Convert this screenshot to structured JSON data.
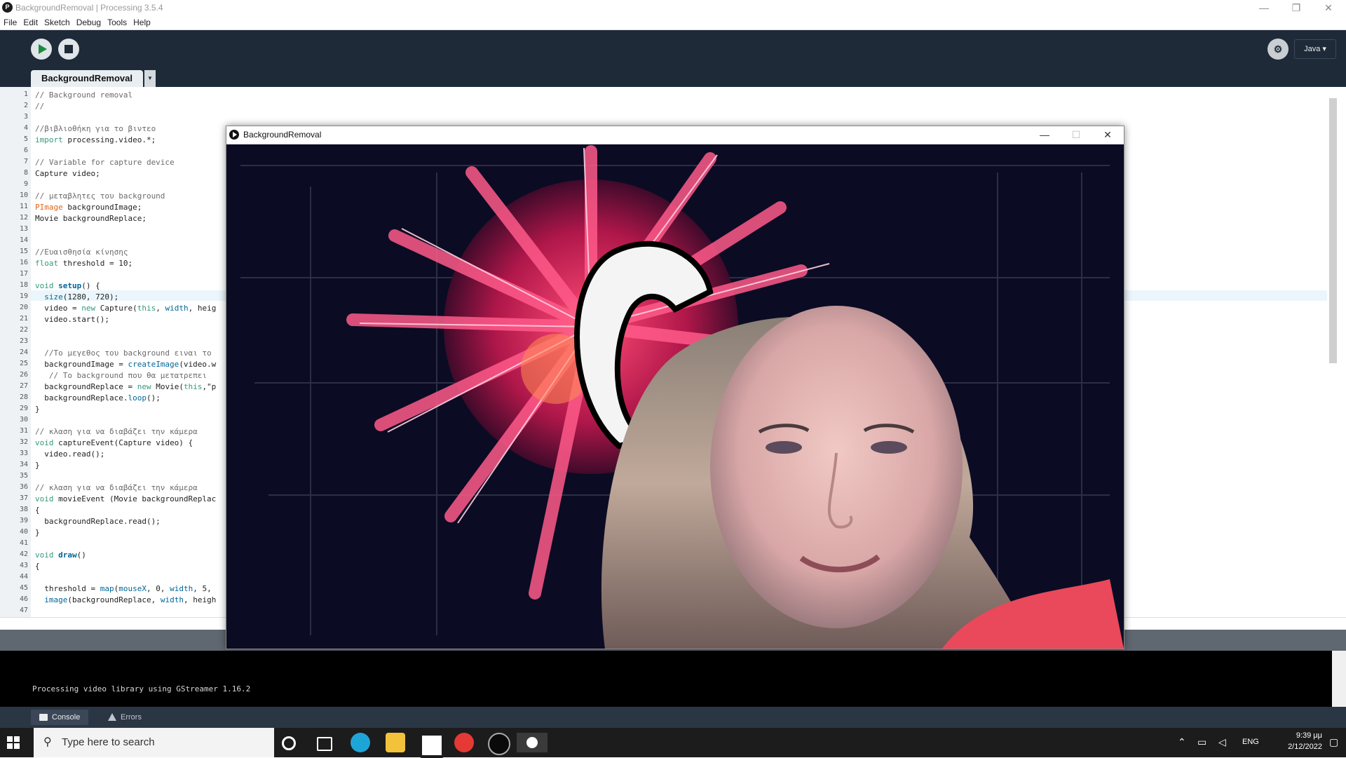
{
  "window": {
    "title": "BackgroundRemoval | Processing 3.5.4",
    "logo_letter": "P"
  },
  "window_controls": {
    "minimize": "—",
    "maximize": "❐",
    "close": "✕"
  },
  "menu": [
    "File",
    "Edit",
    "Sketch",
    "Debug",
    "Tools",
    "Help"
  ],
  "toolbar": {
    "run_icon": "play-icon",
    "stop_icon": "stop-icon",
    "debug_icon": "debug-icon",
    "mode": "Java ▾"
  },
  "tab": {
    "label": "BackgroundRemoval",
    "menu_glyph": "▼"
  },
  "code_lines": [
    {
      "n": "1",
      "t": "// Background removal"
    },
    {
      "n": "2",
      "t": "//"
    },
    {
      "n": "3",
      "t": ""
    },
    {
      "n": "4",
      "t": "//βιβλιοθήκη για το βιντεο"
    },
    {
      "n": "5",
      "t": "import processing.video.*;"
    },
    {
      "n": "6",
      "t": ""
    },
    {
      "n": "7",
      "t": "// Variable for capture device"
    },
    {
      "n": "8",
      "t": "Capture video;"
    },
    {
      "n": "9",
      "t": ""
    },
    {
      "n": "10",
      "t": "// μεταβλητες του background"
    },
    {
      "n": "11",
      "t": "PImage backgroundImage;"
    },
    {
      "n": "12",
      "t": "Movie backgroundReplace;"
    },
    {
      "n": "13",
      "t": ""
    },
    {
      "n": "14",
      "t": ""
    },
    {
      "n": "15",
      "t": "//Ευαισθησία κίνησης"
    },
    {
      "n": "16",
      "t": "float threshold = 10;"
    },
    {
      "n": "17",
      "t": ""
    },
    {
      "n": "18",
      "t": "void setup() {"
    },
    {
      "n": "19",
      "t": "  size(1280, 720);"
    },
    {
      "n": "20",
      "t": "  video = new Capture(this, width, heig"
    },
    {
      "n": "21",
      "t": "  video.start();"
    },
    {
      "n": "22",
      "t": ""
    },
    {
      "n": "23",
      "t": ""
    },
    {
      "n": "24",
      "t": "  //Το μεγεθος του background ειναι το"
    },
    {
      "n": "25",
      "t": "  backgroundImage = createImage(video.w"
    },
    {
      "n": "26",
      "t": "   // Το background που θα μετατρεπει"
    },
    {
      "n": "27",
      "t": "  backgroundReplace = new Movie(this,\"p"
    },
    {
      "n": "28",
      "t": "  backgroundReplace.loop();"
    },
    {
      "n": "29",
      "t": "}"
    },
    {
      "n": "30",
      "t": ""
    },
    {
      "n": "31",
      "t": "// κλαση για να διαβάζει την κάμερα"
    },
    {
      "n": "32",
      "t": "void captureEvent(Capture video) {"
    },
    {
      "n": "33",
      "t": "  video.read();"
    },
    {
      "n": "34",
      "t": "}"
    },
    {
      "n": "35",
      "t": ""
    },
    {
      "n": "36",
      "t": "// κλαση για να διαβάζει την κάμερα"
    },
    {
      "n": "37",
      "t": "void movieEvent (Movie backgroundReplac"
    },
    {
      "n": "38",
      "t": "{"
    },
    {
      "n": "39",
      "t": "  backgroundReplace.read();"
    },
    {
      "n": "40",
      "t": "}"
    },
    {
      "n": "41",
      "t": ""
    },
    {
      "n": "42",
      "t": "void draw()"
    },
    {
      "n": "43",
      "t": "{"
    },
    {
      "n": "44",
      "t": ""
    },
    {
      "n": "45",
      "t": "  threshold = map(mouseX, 0, width, 5,"
    },
    {
      "n": "46",
      "t": "  image(backgroundReplace, width, heigh"
    },
    {
      "n": "47",
      "t": ""
    }
  ],
  "console": {
    "output": "Processing video library using GStreamer 1.16.2"
  },
  "console_tabs": {
    "console": "Console",
    "errors": "Errors"
  },
  "sketch_window": {
    "title": "BackgroundRemoval",
    "minimize": "—",
    "maximize": "☐",
    "close": "✕"
  },
  "taskbar": {
    "search_placeholder": "Type here to search",
    "language": "ENG",
    "time": "9:39 μμ",
    "date": "2/12/2022"
  },
  "colors": {
    "toolbar_bg": "#1e2a38",
    "run_green": "#1d8b3e",
    "keyword": "#33997e",
    "type": "#e2661a",
    "function": "#006699"
  }
}
